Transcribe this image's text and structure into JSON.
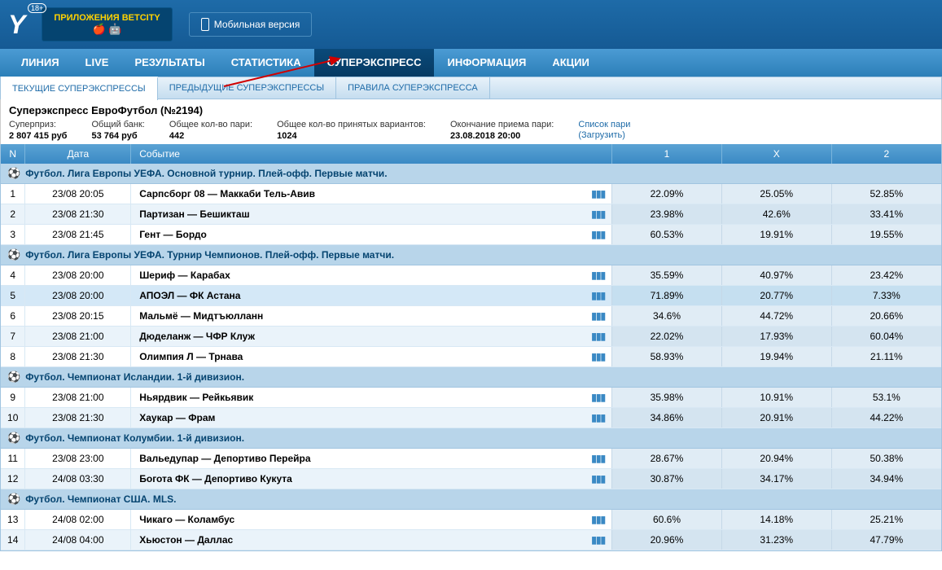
{
  "header": {
    "age_badge": "18+",
    "app_button": "ПРИЛОЖЕНИЯ BETCITY",
    "mobile_button": "Мобильная версия"
  },
  "mainnav": [
    {
      "label": "ЛИНИЯ",
      "active": false
    },
    {
      "label": "LIVE",
      "active": false
    },
    {
      "label": "РЕЗУЛЬТАТЫ",
      "active": false
    },
    {
      "label": "СТАТИСТИКА",
      "active": false
    },
    {
      "label": "СУПЕРЭКСПРЕСС",
      "active": true
    },
    {
      "label": "ИНФОРМАЦИЯ",
      "active": false
    },
    {
      "label": "АКЦИИ",
      "active": false
    }
  ],
  "subnav": [
    {
      "label": "ТЕКУЩИЕ СУПЕРЭКСПРЕССЫ",
      "active": true
    },
    {
      "label": "ПРЕДЫДУЩИЕ СУПЕРЭКСПРЕССЫ",
      "active": false
    },
    {
      "label": "ПРАВИЛА СУПЕРЭКСПРЕССА",
      "active": false
    }
  ],
  "page_title": "Суперэкспресс ЕвроФутбол (№2194)",
  "stats": {
    "superprize_label": "Суперприз:",
    "superprize_value": "2 807 415 руб",
    "bank_label": "Общий банк:",
    "bank_value": "53 764 руб",
    "bets_label": "Общее кол-во пари:",
    "bets_value": "442",
    "variants_label": "Общее кол-во принятых вариантов:",
    "variants_value": "1024",
    "deadline_label": "Окончание приема пари:",
    "deadline_value": "23.08.2018 20:00",
    "link_list": "Список пари",
    "link_download": "(Загрузить)"
  },
  "columns": {
    "n": "N",
    "date": "Дата",
    "event": "Событие",
    "c1": "1",
    "cx": "X",
    "c2": "2"
  },
  "groups": [
    {
      "title": "Футбол. Лига Европы УЕФА. Основной турнир. Плей-офф. Первые матчи.",
      "rows": [
        {
          "n": "1",
          "date": "23/08 20:05",
          "event": "Сарпсборг 08 — Маккаби Тель-Авив",
          "v1": "22.09%",
          "vx": "25.05%",
          "v2": "52.85%"
        },
        {
          "n": "2",
          "date": "23/08 21:30",
          "event": "Партизан — Бешикташ",
          "v1": "23.98%",
          "vx": "42.6%",
          "v2": "33.41%"
        },
        {
          "n": "3",
          "date": "23/08 21:45",
          "event": "Гент — Бордо",
          "v1": "60.53%",
          "vx": "19.91%",
          "v2": "19.55%"
        }
      ]
    },
    {
      "title": "Футбол. Лига Европы УЕФА. Турнир Чемпионов. Плей-офф. Первые матчи.",
      "rows": [
        {
          "n": "4",
          "date": "23/08 20:00",
          "event": "Шериф — Карабах",
          "v1": "35.59%",
          "vx": "40.97%",
          "v2": "23.42%"
        },
        {
          "n": "5",
          "date": "23/08 20:00",
          "event": "АПОЭЛ — ФК Астана",
          "v1": "71.89%",
          "vx": "20.77%",
          "v2": "7.33%",
          "sel": true
        },
        {
          "n": "6",
          "date": "23/08 20:15",
          "event": "Мальмё — Мидтъюлланн",
          "v1": "34.6%",
          "vx": "44.72%",
          "v2": "20.66%"
        },
        {
          "n": "7",
          "date": "23/08 21:00",
          "event": "Дюделанж — ЧФР Клуж",
          "v1": "22.02%",
          "vx": "17.93%",
          "v2": "60.04%"
        },
        {
          "n": "8",
          "date": "23/08 21:30",
          "event": "Олимпия Л — Трнава",
          "v1": "58.93%",
          "vx": "19.94%",
          "v2": "21.11%"
        }
      ]
    },
    {
      "title": "Футбол. Чемпионат Исландии. 1-й дивизион.",
      "rows": [
        {
          "n": "9",
          "date": "23/08 21:00",
          "event": "Ньярдвик — Рейкьявик",
          "v1": "35.98%",
          "vx": "10.91%",
          "v2": "53.1%"
        },
        {
          "n": "10",
          "date": "23/08 21:30",
          "event": "Хаукар — Фрам",
          "v1": "34.86%",
          "vx": "20.91%",
          "v2": "44.22%"
        }
      ]
    },
    {
      "title": "Футбол. Чемпионат Колумбии. 1-й дивизион.",
      "rows": [
        {
          "n": "11",
          "date": "23/08 23:00",
          "event": "Вальедупар — Депортиво Перейра",
          "v1": "28.67%",
          "vx": "20.94%",
          "v2": "50.38%"
        },
        {
          "n": "12",
          "date": "24/08 03:30",
          "event": "Богота ФК — Депортиво Кукута",
          "v1": "30.87%",
          "vx": "34.17%",
          "v2": "34.94%"
        }
      ]
    },
    {
      "title": "Футбол. Чемпионат США. MLS.",
      "rows": [
        {
          "n": "13",
          "date": "24/08 02:00",
          "event": "Чикаго — Коламбус",
          "v1": "60.6%",
          "vx": "14.18%",
          "v2": "25.21%"
        },
        {
          "n": "14",
          "date": "24/08 04:00",
          "event": "Хьюстон — Даллас",
          "v1": "20.96%",
          "vx": "31.23%",
          "v2": "47.79%"
        }
      ]
    }
  ]
}
